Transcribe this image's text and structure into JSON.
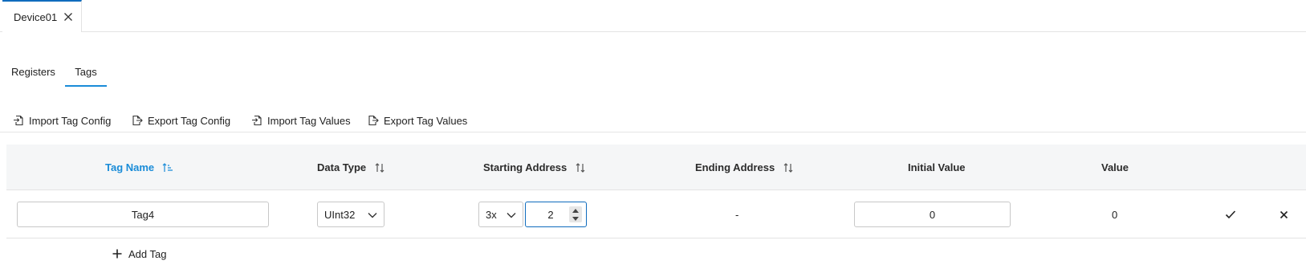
{
  "document_tab": {
    "label": "Device01",
    "close_icon": "close-icon"
  },
  "subtabs": [
    {
      "label": "Registers",
      "active": false
    },
    {
      "label": "Tags",
      "active": true
    }
  ],
  "toolbar": {
    "import_config": "Import Tag Config",
    "export_config": "Export Tag Config",
    "import_values": "Import Tag Values",
    "export_values": "Export Tag Values"
  },
  "columns": {
    "tag_name": "Tag Name",
    "data_type": "Data Type",
    "starting_address": "Starting Address",
    "ending_address": "Ending Address",
    "initial_value": "Initial Value",
    "value": "Value"
  },
  "row": {
    "tag_name": "Tag4",
    "data_type": "UInt32",
    "address_space": "3x",
    "starting_address": "2",
    "ending_address": "-",
    "initial_value": "0",
    "value": "0"
  },
  "add_tag": "Add Tag",
  "colors": {
    "accent": "#1a8cd8",
    "focus_border": "#0f6cbd",
    "header_bg": "#f5f6f7"
  }
}
